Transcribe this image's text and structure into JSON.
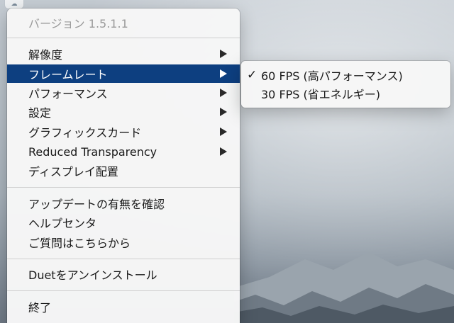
{
  "menu": {
    "version": "バージョン 1.5.1.1",
    "items": [
      {
        "label": "解像度"
      },
      {
        "label": "フレームレート"
      },
      {
        "label": "パフォーマンス"
      },
      {
        "label": "設定"
      },
      {
        "label": "グラフィックスカード"
      },
      {
        "label": "Reduced Transparency"
      },
      {
        "label": "ディスプレイ配置"
      },
      {
        "label": "アップデートの有無を確認"
      },
      {
        "label": "ヘルプセンタ"
      },
      {
        "label": "ご質問はこちらから"
      },
      {
        "label": "Duetをアンインストール"
      },
      {
        "label": "終了"
      }
    ]
  },
  "submenu": {
    "items": [
      {
        "label": "60 FPS (高パフォーマンス)",
        "checked": true
      },
      {
        "label": "30 FPS (省エネルギー)",
        "checked": false
      }
    ],
    "check_glyph": "✓"
  },
  "colors": {
    "highlight": "#0d3f80",
    "menu_bg": "#f6f6f6",
    "disabled_text": "#9a9a9a"
  }
}
